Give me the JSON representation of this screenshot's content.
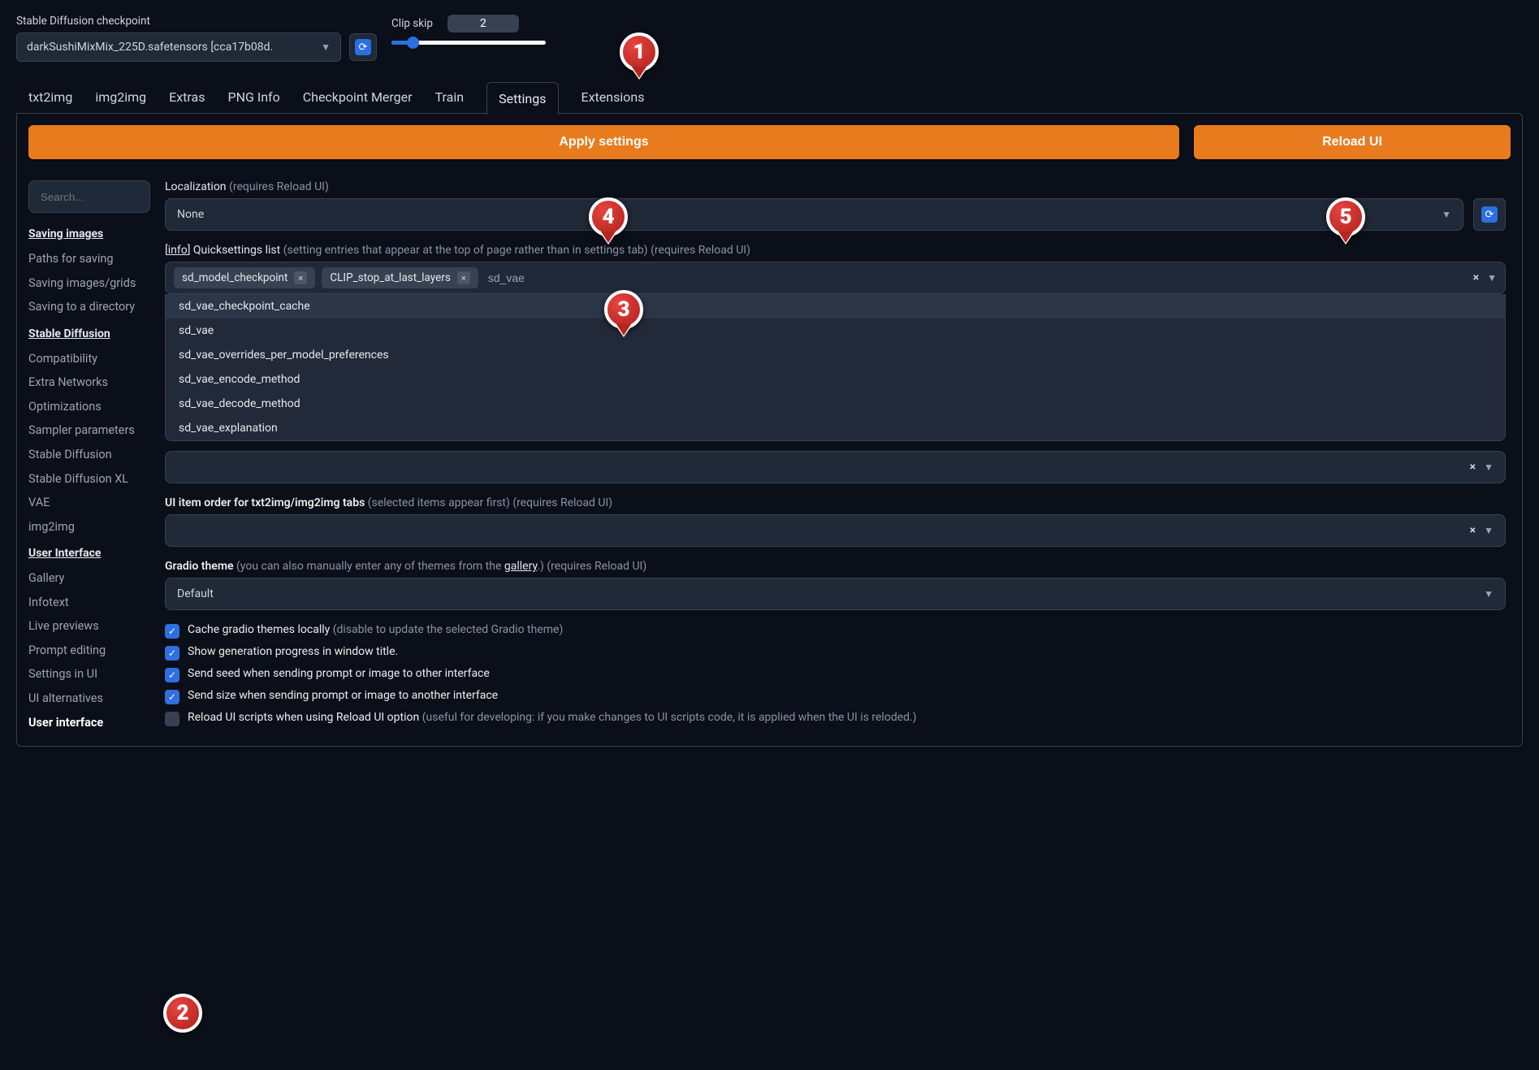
{
  "topbar": {
    "checkpoint_label": "Stable Diffusion checkpoint",
    "checkpoint_value": "darkSushiMixMix_225D.safetensors [cca17b08d.",
    "clip_label": "Clip skip",
    "clip_value": "2"
  },
  "tabs": [
    "txt2img",
    "img2img",
    "Extras",
    "PNG Info",
    "Checkpoint Merger",
    "Train",
    "Settings",
    "Extensions"
  ],
  "active_tab": "Settings",
  "buttons": {
    "apply": "Apply settings",
    "reload": "Reload UI"
  },
  "sidebar": {
    "search_placeholder": "Search...",
    "groups": [
      {
        "head": "Saving images",
        "items": [
          "Paths for saving",
          "Saving images/grids",
          "Saving to a directory"
        ]
      },
      {
        "head": "Stable Diffusion",
        "items": [
          "Compatibility",
          "Extra Networks",
          "Optimizations",
          "Sampler parameters",
          "Stable Diffusion",
          "Stable Diffusion XL",
          "VAE",
          "img2img"
        ]
      },
      {
        "head": "User Interface",
        "items": [
          "Gallery",
          "Infotext",
          "Live previews",
          "Prompt editing",
          "Settings in UI",
          "UI alternatives",
          "User interface"
        ]
      }
    ],
    "active_item": "User interface"
  },
  "settings": {
    "localization_label": "Localization",
    "localization_hint": "(requires Reload UI)",
    "localization_value": "None",
    "quicksettings_pre": "[",
    "quicksettings_info": "info",
    "quicksettings_label": "] Quicksettings list",
    "quicksettings_hint": "(setting entries that appear at the top of page rather than in settings tab) (requires Reload UI)",
    "quicksettings_tokens": [
      "sd_model_checkpoint",
      "CLIP_stop_at_last_layers"
    ],
    "quicksettings_input": "sd_vae",
    "dropdown_options": [
      "sd_vae_checkpoint_cache",
      "sd_vae",
      "sd_vae_overrides_per_model_preferences",
      "sd_vae_encode_method",
      "sd_vae_decode_method",
      "sd_vae_explanation"
    ],
    "ui_order_label": "UI item order for txt2img/img2img tabs",
    "ui_order_hint": "(selected items appear first) (requires Reload UI)",
    "gradio_label": "Gradio theme",
    "gradio_hint_pre": "(you can also manually enter any of themes from the ",
    "gradio_hint_link": "gallery",
    "gradio_hint_post": ".) (requires Reload UI)",
    "gradio_value": "Default",
    "checks": [
      {
        "checked": true,
        "text": "Cache gradio themes locally",
        "hint": "(disable to update the selected Gradio theme)"
      },
      {
        "checked": true,
        "text": "Show generation progress in window title."
      },
      {
        "checked": true,
        "text": "Send seed when sending prompt or image to other interface"
      },
      {
        "checked": true,
        "text": "Send size when sending prompt or image to another interface"
      },
      {
        "checked": false,
        "text": "Reload UI scripts when using Reload UI option",
        "hint": "(useful for developing: if you make changes to UI scripts code, it is applied when the UI is reloded.)"
      }
    ]
  },
  "markers": {
    "m1": "1",
    "m2": "2",
    "m3": "3",
    "m4": "4",
    "m5": "5"
  }
}
